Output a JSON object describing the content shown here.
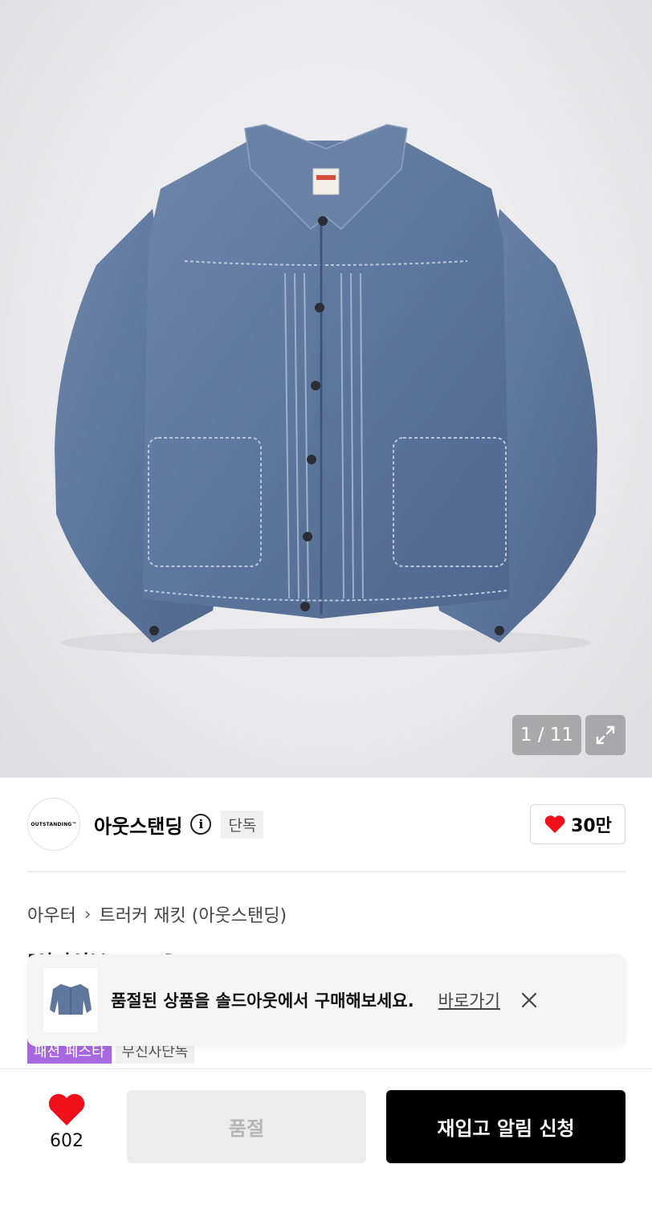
{
  "gallery": {
    "counter": "1 / 11",
    "image_alt": "denim-jacket-photo"
  },
  "brand": {
    "logo_text": "OUTSTANDING™",
    "name": "아웃스탠딩",
    "info_icon": "i",
    "exclusive_badge": "단독",
    "like_count": "30만"
  },
  "breadcrumb": {
    "category": "아우터",
    "separator": "›",
    "subcategory": "트러커 재킷 (아웃스탠딩)"
  },
  "product": {
    "title_partial": "[아카이브 PICK] TRIPLE PLEATS JACKET A. BLU"
  },
  "tags": [
    "패션 페스타",
    "무신사단독"
  ],
  "toast": {
    "message": "품절된 상품을 솔드아웃에서 구매해보세요.",
    "link_label": "바로가기"
  },
  "bottom_bar": {
    "like_count": "602",
    "soldout_label": "품절",
    "restock_label": "재입고 알림 신청"
  },
  "colors": {
    "heart": "#f0101a",
    "tag_purple": "#a868e0",
    "restock_button": "#000000"
  }
}
